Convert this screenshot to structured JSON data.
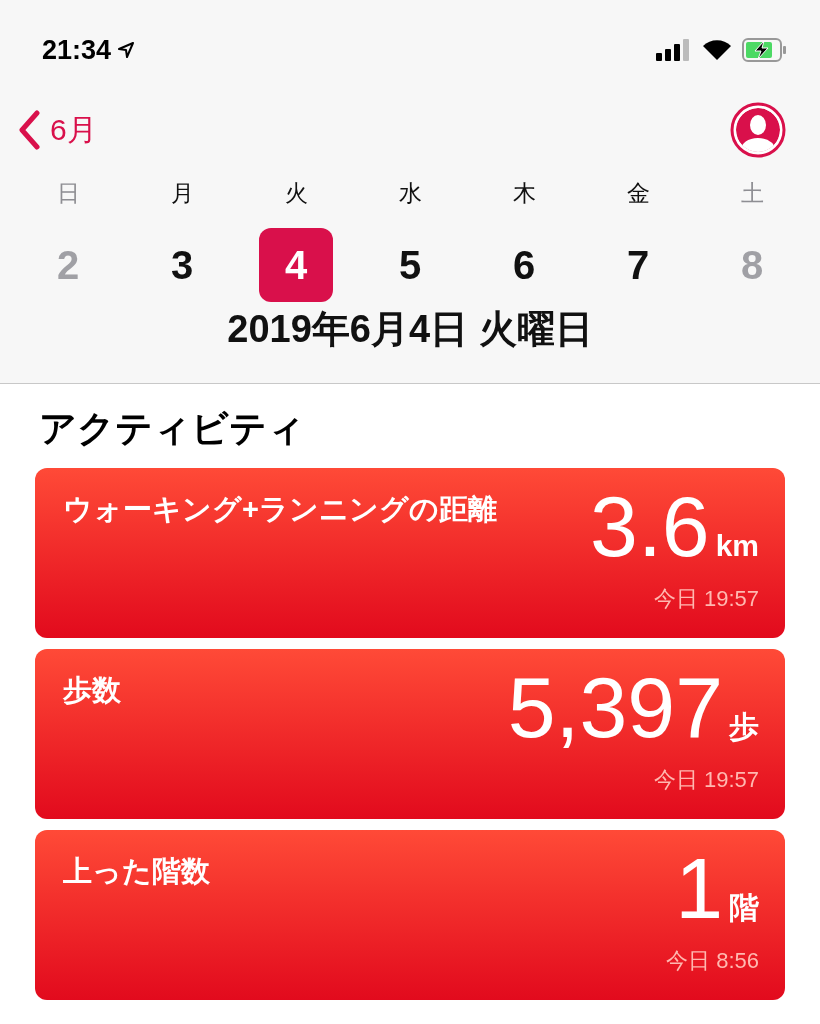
{
  "status_bar": {
    "time": "21:34"
  },
  "nav": {
    "back_label": "6月"
  },
  "week": [
    {
      "weekday": "日",
      "date": "2",
      "dimmed": true,
      "selected": false
    },
    {
      "weekday": "月",
      "date": "3",
      "dimmed": false,
      "selected": false
    },
    {
      "weekday": "火",
      "date": "4",
      "dimmed": false,
      "selected": true
    },
    {
      "weekday": "水",
      "date": "5",
      "dimmed": false,
      "selected": false
    },
    {
      "weekday": "木",
      "date": "6",
      "dimmed": false,
      "selected": false
    },
    {
      "weekday": "金",
      "date": "7",
      "dimmed": false,
      "selected": false
    },
    {
      "weekday": "土",
      "date": "8",
      "dimmed": true,
      "selected": false
    }
  ],
  "date_title": "2019年6月4日 火曜日",
  "section_title": "アクティビティ",
  "cards": [
    {
      "title": "ウォーキング+ランニングの距離",
      "value": "3.6",
      "unit": "km",
      "time": "今日 19:57"
    },
    {
      "title": "歩数",
      "value": "5,397",
      "unit": "歩",
      "time": "今日 19:57"
    },
    {
      "title": "上った階数",
      "value": "1",
      "unit": "階",
      "time": "今日 8:56"
    }
  ]
}
